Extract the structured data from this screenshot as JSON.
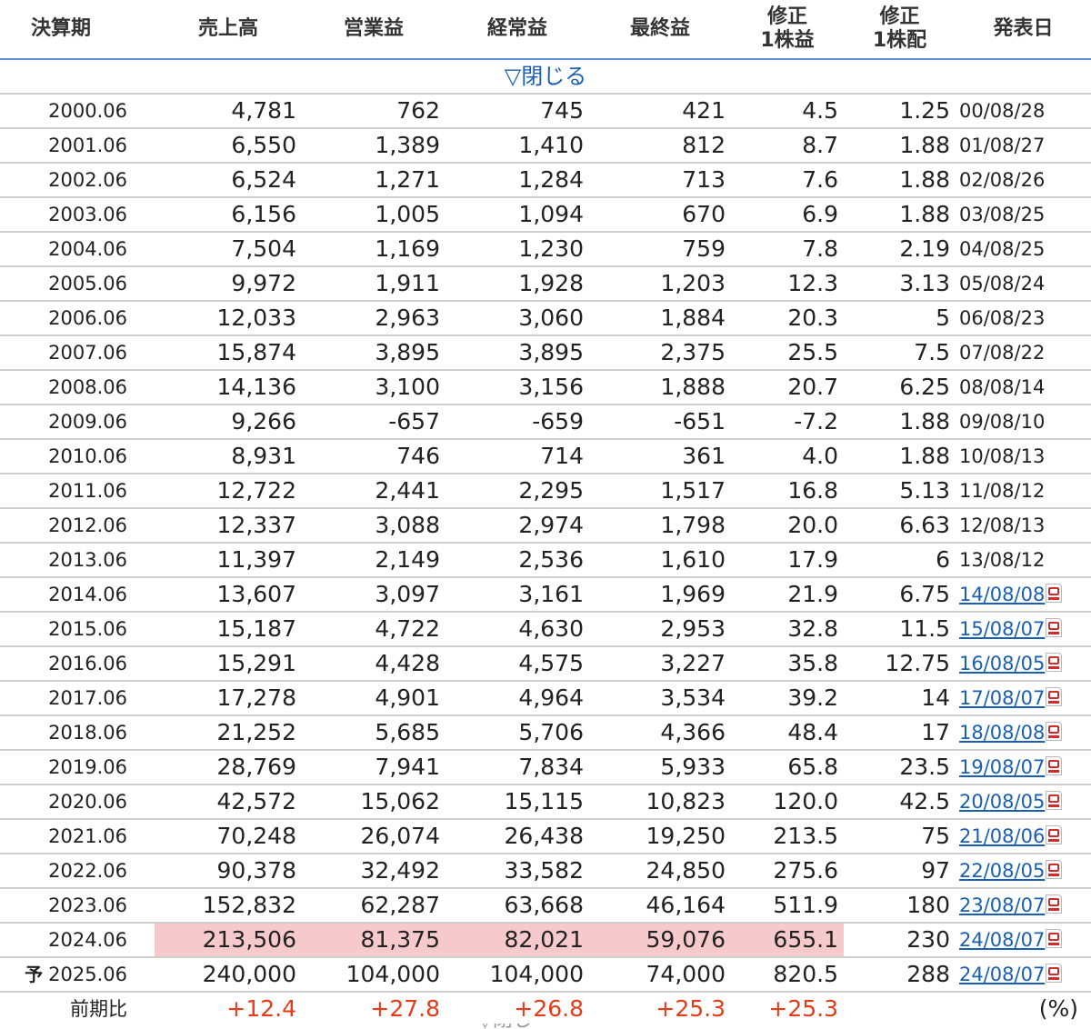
{
  "headers": {
    "period": "決算期",
    "sales": "売上高",
    "operating": "営業益",
    "ordinary": "経常益",
    "net": "最終益",
    "eps_l1": "修正",
    "eps_l2": "1株益",
    "div_l1": "修正",
    "div_l2": "1株配",
    "date": "発表日"
  },
  "toggle_label": "▽閉じる",
  "rows": [
    {
      "period": "2000.06",
      "sales": "4,781",
      "operating": "762",
      "ordinary": "745",
      "net": "421",
      "eps": "4.5",
      "dividend": "1.25",
      "date": "00/08/28"
    },
    {
      "period": "2001.06",
      "sales": "6,550",
      "operating": "1,389",
      "ordinary": "1,410",
      "net": "812",
      "eps": "8.7",
      "dividend": "1.88",
      "date": "01/08/27"
    },
    {
      "period": "2002.06",
      "sales": "6,524",
      "operating": "1,271",
      "ordinary": "1,284",
      "net": "713",
      "eps": "7.6",
      "dividend": "1.88",
      "date": "02/08/26"
    },
    {
      "period": "2003.06",
      "sales": "6,156",
      "operating": "1,005",
      "ordinary": "1,094",
      "net": "670",
      "eps": "6.9",
      "dividend": "1.88",
      "date": "03/08/25"
    },
    {
      "period": "2004.06",
      "sales": "7,504",
      "operating": "1,169",
      "ordinary": "1,230",
      "net": "759",
      "eps": "7.8",
      "dividend": "2.19",
      "date": "04/08/25"
    },
    {
      "period": "2005.06",
      "sales": "9,972",
      "operating": "1,911",
      "ordinary": "1,928",
      "net": "1,203",
      "eps": "12.3",
      "dividend": "3.13",
      "date": "05/08/24"
    },
    {
      "period": "2006.06",
      "sales": "12,033",
      "operating": "2,963",
      "ordinary": "3,060",
      "net": "1,884",
      "eps": "20.3",
      "dividend": "5",
      "date": "06/08/23"
    },
    {
      "period": "2007.06",
      "sales": "15,874",
      "operating": "3,895",
      "ordinary": "3,895",
      "net": "2,375",
      "eps": "25.5",
      "dividend": "7.5",
      "date": "07/08/22"
    },
    {
      "period": "2008.06",
      "sales": "14,136",
      "operating": "3,100",
      "ordinary": "3,156",
      "net": "1,888",
      "eps": "20.7",
      "dividend": "6.25",
      "date": "08/08/14"
    },
    {
      "period": "2009.06",
      "sales": "9,266",
      "operating": "-657",
      "ordinary": "-659",
      "net": "-651",
      "eps": "-7.2",
      "dividend": "1.88",
      "date": "09/08/10"
    },
    {
      "period": "2010.06",
      "sales": "8,931",
      "operating": "746",
      "ordinary": "714",
      "net": "361",
      "eps": "4.0",
      "dividend": "1.88",
      "date": "10/08/13"
    },
    {
      "period": "2011.06",
      "sales": "12,722",
      "operating": "2,441",
      "ordinary": "2,295",
      "net": "1,517",
      "eps": "16.8",
      "dividend": "5.13",
      "date": "11/08/12"
    },
    {
      "period": "2012.06",
      "sales": "12,337",
      "operating": "3,088",
      "ordinary": "2,974",
      "net": "1,798",
      "eps": "20.0",
      "dividend": "6.63",
      "date": "12/08/13"
    },
    {
      "period": "2013.06",
      "sales": "11,397",
      "operating": "2,149",
      "ordinary": "2,536",
      "net": "1,610",
      "eps": "17.9",
      "dividend": "6",
      "date": "13/08/12"
    },
    {
      "period": "2014.06",
      "sales": "13,607",
      "operating": "3,097",
      "ordinary": "3,161",
      "net": "1,969",
      "eps": "21.9",
      "dividend": "6.75",
      "date": "14/08/08",
      "link": true
    },
    {
      "period": "2015.06",
      "sales": "15,187",
      "operating": "4,722",
      "ordinary": "4,630",
      "net": "2,953",
      "eps": "32.8",
      "dividend": "11.5",
      "date": "15/08/07",
      "link": true
    },
    {
      "period": "2016.06",
      "sales": "15,291",
      "operating": "4,428",
      "ordinary": "4,575",
      "net": "3,227",
      "eps": "35.8",
      "dividend": "12.75",
      "date": "16/08/05",
      "link": true
    },
    {
      "period": "2017.06",
      "sales": "17,278",
      "operating": "4,901",
      "ordinary": "4,964",
      "net": "3,534",
      "eps": "39.2",
      "dividend": "14",
      "date": "17/08/07",
      "link": true
    },
    {
      "period": "2018.06",
      "sales": "21,252",
      "operating": "5,685",
      "ordinary": "5,706",
      "net": "4,366",
      "eps": "48.4",
      "dividend": "17",
      "date": "18/08/08",
      "link": true
    },
    {
      "period": "2019.06",
      "sales": "28,769",
      "operating": "7,941",
      "ordinary": "7,834",
      "net": "5,933",
      "eps": "65.8",
      "dividend": "23.5",
      "date": "19/08/07",
      "link": true
    },
    {
      "period": "2020.06",
      "sales": "42,572",
      "operating": "15,062",
      "ordinary": "15,115",
      "net": "10,823",
      "eps": "120.0",
      "dividend": "42.5",
      "date": "20/08/05",
      "link": true
    },
    {
      "period": "2021.06",
      "sales": "70,248",
      "operating": "26,074",
      "ordinary": "26,438",
      "net": "19,250",
      "eps": "213.5",
      "dividend": "75",
      "date": "21/08/06",
      "link": true
    },
    {
      "period": "2022.06",
      "sales": "90,378",
      "operating": "32,492",
      "ordinary": "33,582",
      "net": "24,850",
      "eps": "275.6",
      "dividend": "97",
      "date": "22/08/05",
      "link": true
    },
    {
      "period": "2023.06",
      "sales": "152,832",
      "operating": "62,287",
      "ordinary": "63,668",
      "net": "46,164",
      "eps": "511.9",
      "dividend": "180",
      "date": "23/08/07",
      "link": true
    },
    {
      "period": "2024.06",
      "sales": "213,506",
      "operating": "81,375",
      "ordinary": "82,021",
      "net": "59,076",
      "eps": "655.1",
      "dividend": "230",
      "date": "24/08/07",
      "link": true,
      "highlight": true
    },
    {
      "period": "2025.06",
      "mark": "予",
      "sales": "240,000",
      "operating": "104,000",
      "ordinary": "104,000",
      "net": "74,000",
      "eps": "820.5",
      "dividend": "288",
      "date": "24/08/07",
      "link": true
    }
  ],
  "ratio": {
    "label": "前期比",
    "sales": "+12.4",
    "operating": "+27.8",
    "ordinary": "+26.8",
    "net": "+25.3",
    "eps": "+25.3",
    "unit": "(%)"
  },
  "colors": {
    "header_border": "#5b8fd6",
    "link": "#1a5fb4",
    "highlight": "#f6c9cc",
    "positive": "#e83a18"
  },
  "icons": {
    "pdf": "pdf-icon"
  }
}
